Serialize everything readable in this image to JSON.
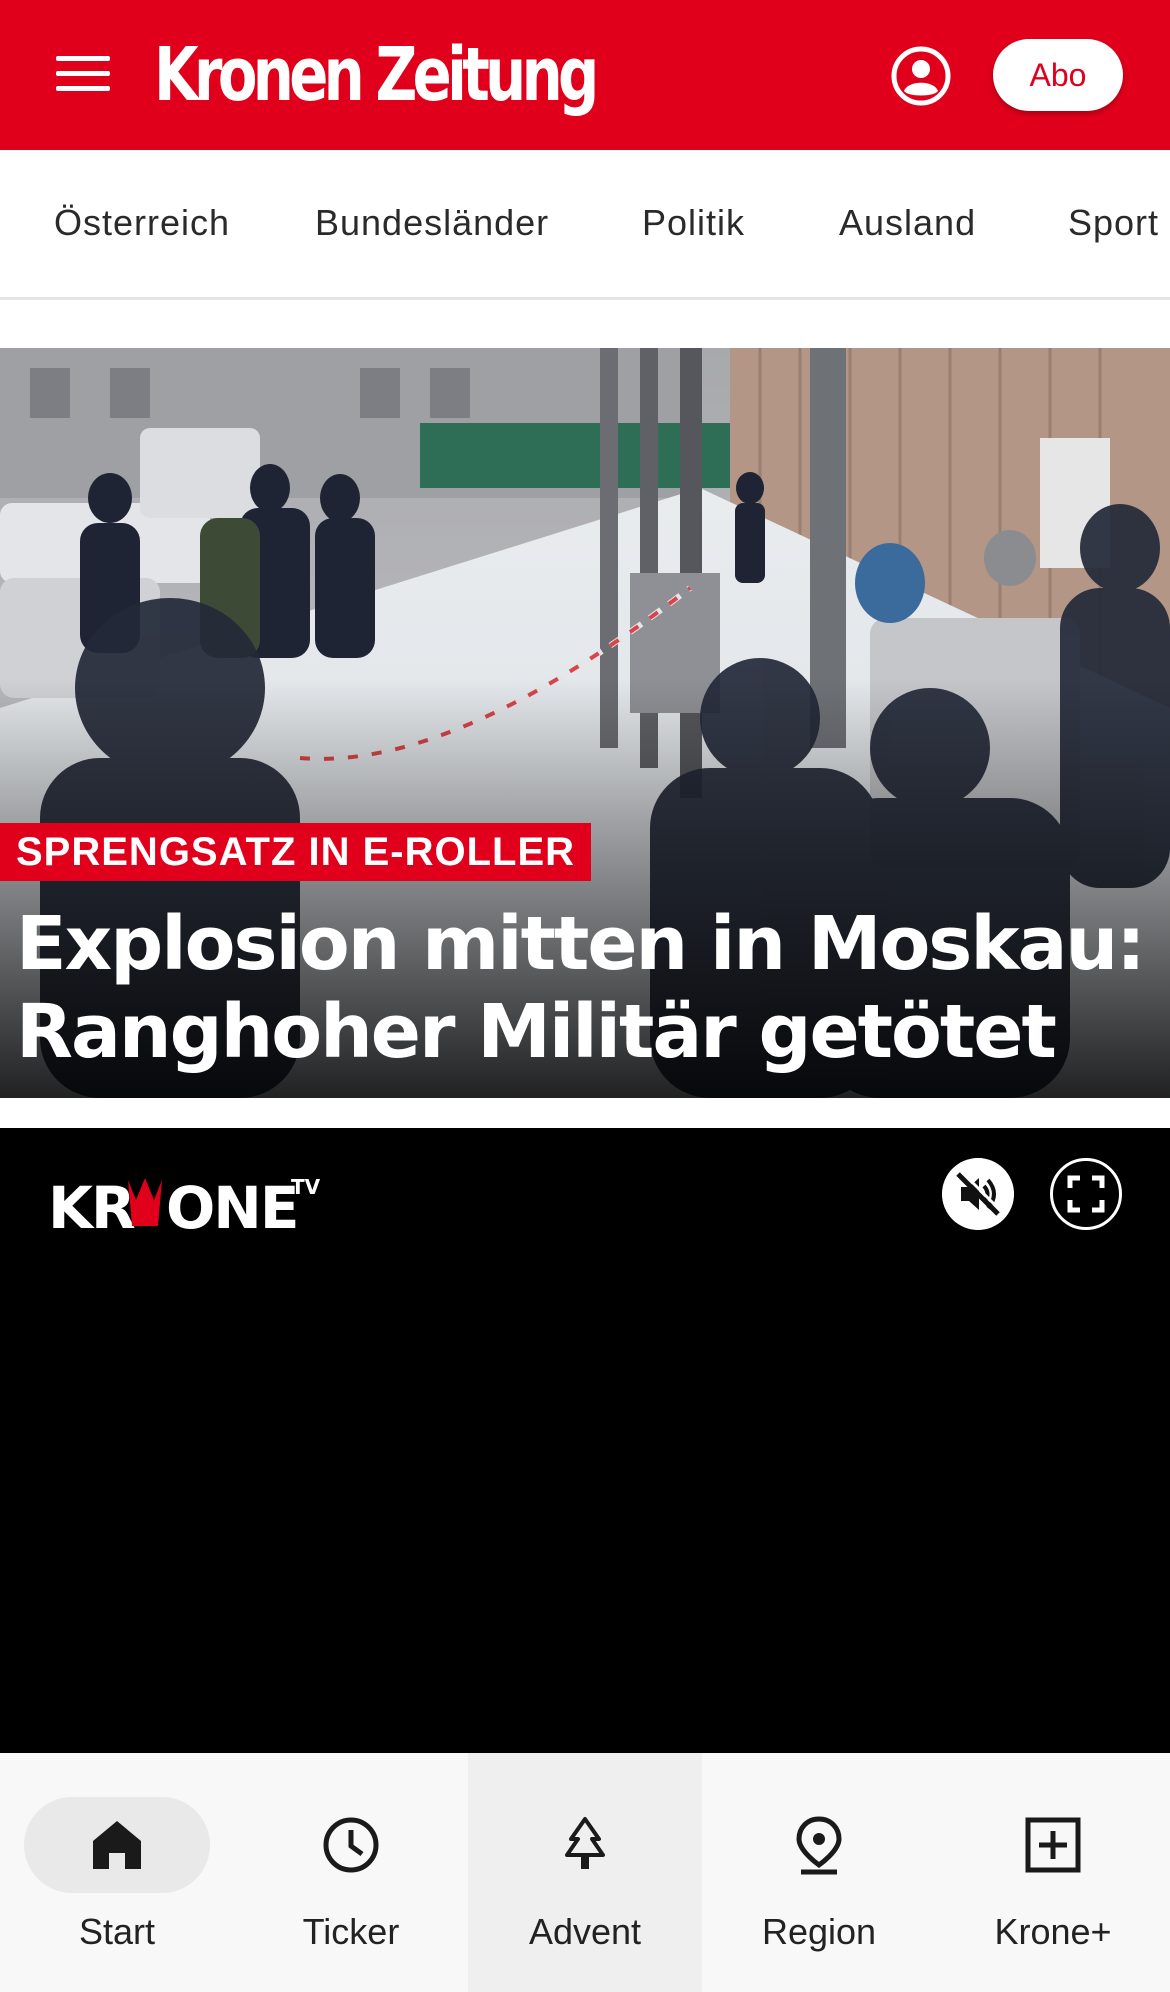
{
  "header": {
    "menu_icon": "hamburger-menu-icon",
    "logo": "Kronen Zeitung",
    "account_icon": "user-account-icon",
    "abo_label": "Abo",
    "brand_color": "#e1001b"
  },
  "categories": [
    "Österreich",
    "Bundesländer",
    "Politik",
    "Ausland",
    "Sport"
  ],
  "hero": {
    "kicker": "SPRENGSATZ IN E-ROLLER",
    "headline": "Explosion mitten in Moskau: Ranghoher Militär getötet",
    "image_icon": "news-photo"
  },
  "video": {
    "logo": "KRONE TV",
    "mute_icon": "speaker-muted-icon",
    "fullscreen_icon": "fullscreen-icon"
  },
  "bottom_nav": [
    {
      "label": "Start",
      "icon": "home-icon",
      "selected": true
    },
    {
      "label": "Ticker",
      "icon": "clock-icon"
    },
    {
      "label": "Advent",
      "icon": "tree-icon",
      "highlighted": true
    },
    {
      "label": "Region",
      "icon": "location-pin-icon"
    },
    {
      "label": "Krone+",
      "icon": "plus-square-icon"
    }
  ]
}
